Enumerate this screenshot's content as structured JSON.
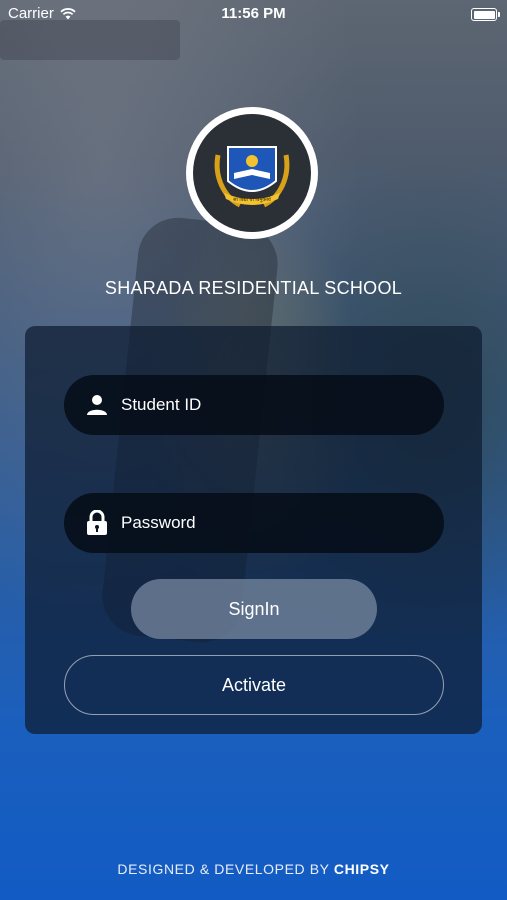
{
  "status_bar": {
    "carrier": "Carrier",
    "time": "11:56 PM"
  },
  "logo": {
    "icon": "school-crest-icon",
    "motto": "सा विद्या या विमुक्तये"
  },
  "school_name": "SHARADA RESIDENTIAL SCHOOL",
  "login_form": {
    "student_id_placeholder": "Student ID",
    "student_id_value": "",
    "password_placeholder": "Password",
    "password_value": "",
    "signin_label": "SignIn",
    "activate_label": "Activate"
  },
  "footer": {
    "prefix": "DESIGNED & DEVELOPED BY",
    "brand": "CHIPSY"
  },
  "colors": {
    "card": "#0e1c30",
    "field": "#050c16",
    "signin_button": "#788aa0",
    "background_bottom": "#125bc4"
  }
}
